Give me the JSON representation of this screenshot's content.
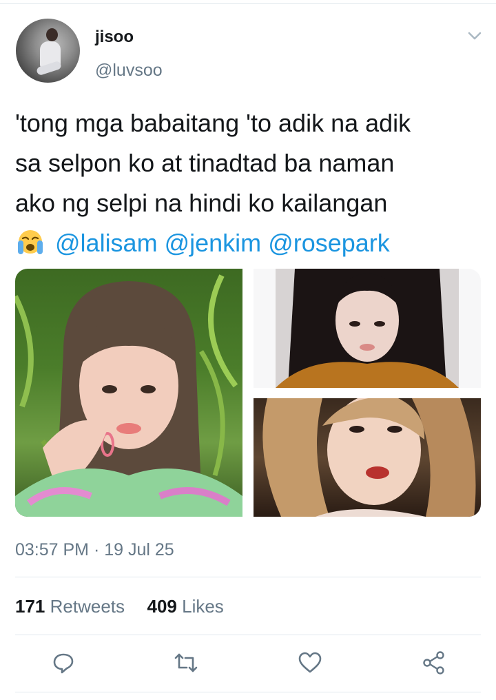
{
  "user": {
    "display_name": "jisoo",
    "handle": "@luvsoo"
  },
  "tweet": {
    "lines": [
      "'tong mga babaitang 'to adik na adik",
      "sa selpon ko at tinadtad ba naman",
      "ako ng selpi na hindi ko kailangan"
    ],
    "mentions": [
      "@lalisam",
      "@jenkim",
      "@rosepark"
    ],
    "emoji": "loudly-crying-face-emoji"
  },
  "media": [
    "photo-1",
    "photo-2",
    "photo-3"
  ],
  "timestamp": "03:57 PM · 19 Jul 25",
  "stats": {
    "retweets_count": "171",
    "retweets_label": "Retweets",
    "likes_count": "409",
    "likes_label": "Likes"
  },
  "actions": [
    "reply-icon",
    "retweet-icon",
    "like-icon",
    "share-icon"
  ],
  "colors": {
    "text": "#14171a",
    "secondary": "#657786",
    "link": "#1b95e0",
    "divider": "#e1e8ed"
  }
}
